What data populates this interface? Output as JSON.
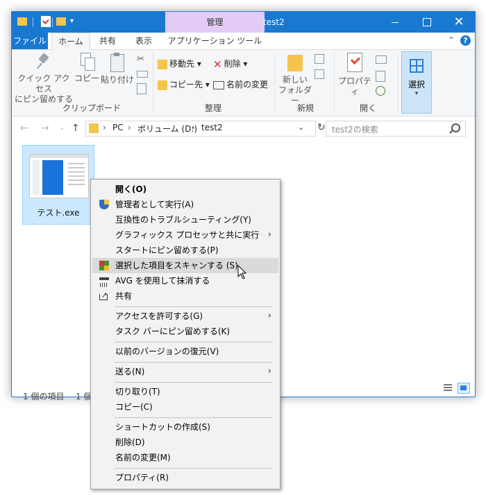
{
  "window": {
    "title": "test2",
    "contextual_tab_title": "管理"
  },
  "ribbon_tabs": {
    "file": "ファイル",
    "home": "ホーム",
    "share": "共有",
    "view": "表示",
    "app_tools": "アプリケーション ツール"
  },
  "ribbon": {
    "clipboard": {
      "pin_label": "クイック アクセス\nにピン留めする",
      "pin_line1": "クイック アクセス",
      "pin_line2": "にピン留めする",
      "copy": "コピー",
      "paste": "貼り付け",
      "group": "クリップボード"
    },
    "organize": {
      "move_to": "移動先",
      "copy_to": "コピー先",
      "delete": "削除",
      "rename": "名前の変更",
      "group": "整理"
    },
    "new": {
      "new_folder_line1": "新しい",
      "new_folder_line2": "フォルダー",
      "group": "新規"
    },
    "open": {
      "properties": "プロパティ",
      "group": "開く"
    },
    "select": {
      "label": "選択"
    }
  },
  "address": {
    "crumbs": [
      "PC",
      "ボリューム (D:)",
      "test2"
    ],
    "search_placeholder": "test2の検索"
  },
  "file": {
    "name": "テスト.exe"
  },
  "status": {
    "count": "1 個の項目",
    "selected": "1 個"
  },
  "context_menu": {
    "items": [
      {
        "label": "開く(O)"
      },
      {
        "label": "管理者として実行(A)"
      },
      {
        "label": "互換性のトラブルシューティング(Y)"
      },
      {
        "label": "グラフィックス プロセッサと共に実行"
      },
      {
        "label": "スタートにピン留めする(P)"
      },
      {
        "label": "選択した項目をスキャンする (S)"
      },
      {
        "label": "AVG を使用して抹消する"
      },
      {
        "label": "共有"
      },
      {
        "label": "アクセスを許可する(G)"
      },
      {
        "label": "タスク バーにピン留めする(K)"
      },
      {
        "label": "以前のバージョンの復元(V)"
      },
      {
        "label": "送る(N)"
      },
      {
        "label": "切り取り(T)"
      },
      {
        "label": "コピー(C)"
      },
      {
        "label": "ショートカットの作成(S)"
      },
      {
        "label": "削除(D)"
      },
      {
        "label": "名前の変更(M)"
      },
      {
        "label": "プロパティ(R)"
      }
    ],
    "hovered_index": 5
  },
  "colors": {
    "accent": "#1979d1",
    "contextual_tab": "#e2cbf5",
    "selection": "#cce8ff"
  }
}
